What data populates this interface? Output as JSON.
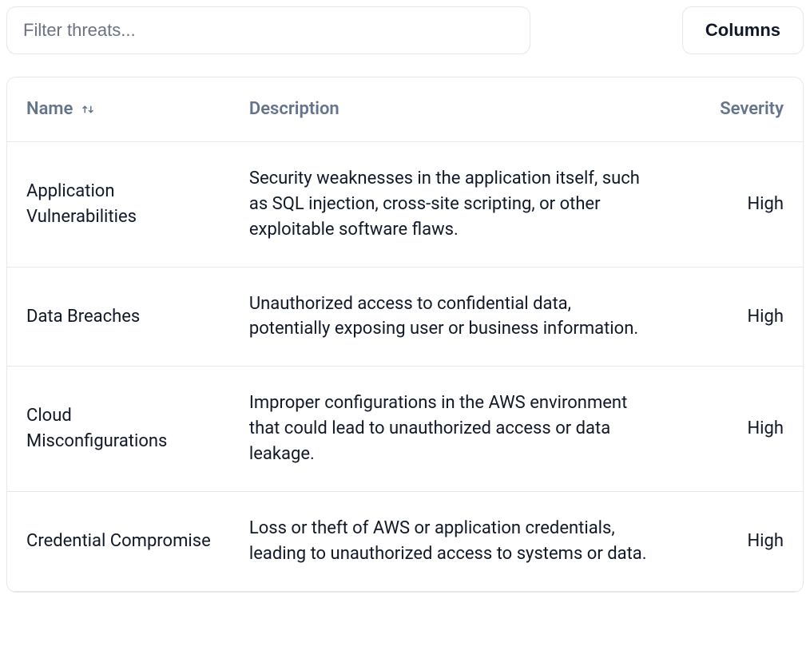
{
  "toolbar": {
    "filter_placeholder": "Filter threats...",
    "columns_label": "Columns"
  },
  "table": {
    "headers": {
      "name": "Name",
      "description": "Description",
      "severity": "Severity"
    },
    "rows": [
      {
        "name": "Application Vulnerabilities",
        "description": "Security weaknesses in the application itself, such as SQL injection, cross-site scripting, or other exploitable software flaws.",
        "severity": "High"
      },
      {
        "name": "Data Breaches",
        "description": "Unauthorized access to confidential data, potentially exposing user or business information.",
        "severity": "High"
      },
      {
        "name": "Cloud Misconfigurations",
        "description": "Improper configurations in the AWS environment that could lead to unauthorized access or data leakage.",
        "severity": "High"
      },
      {
        "name": "Credential Compromise",
        "description": "Loss or theft of AWS or application credentials, leading to unauthorized access to systems or data.",
        "severity": "High"
      }
    ]
  }
}
